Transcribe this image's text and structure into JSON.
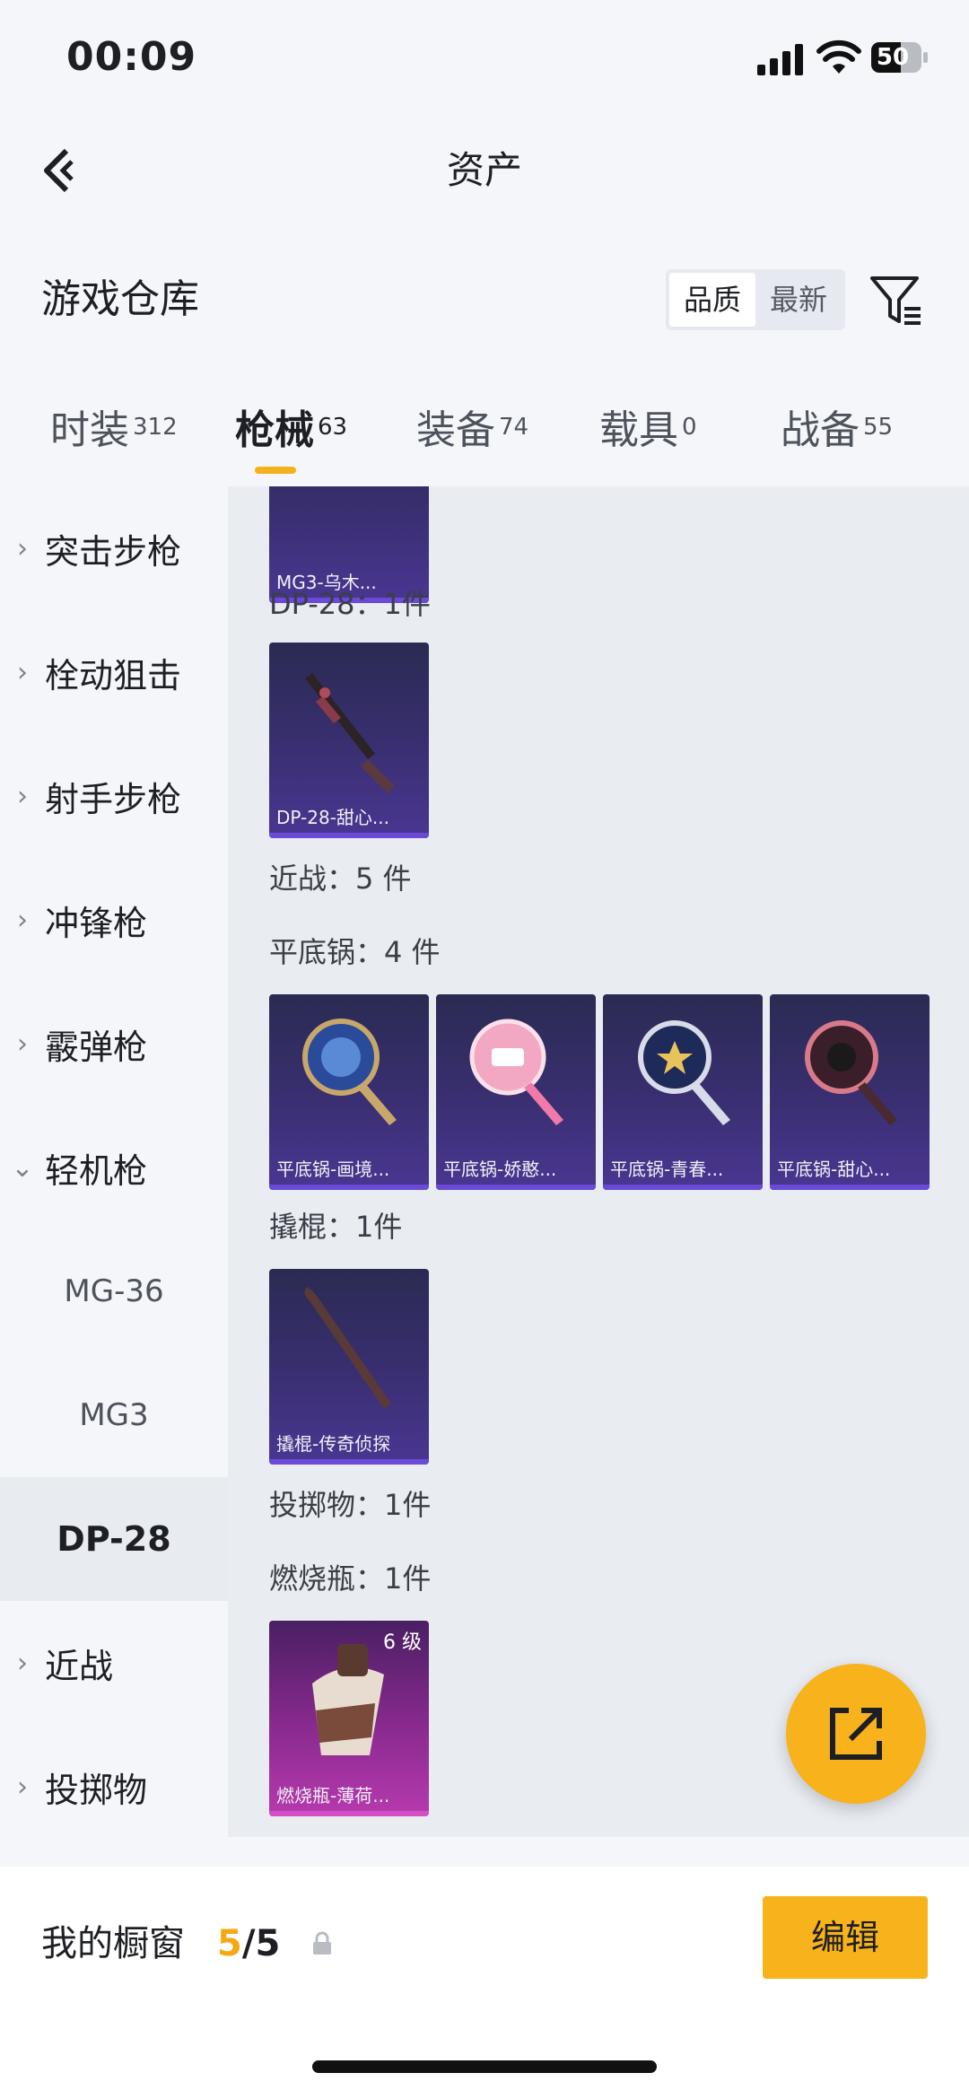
{
  "status_bar": {
    "time": "00:09",
    "battery": "50"
  },
  "header": {
    "title": "资产"
  },
  "section": {
    "title": "游戏仓库",
    "sort_options": [
      "品质",
      "最新"
    ],
    "sort_active": "品质"
  },
  "tabs": [
    {
      "label": "时装",
      "count": "312"
    },
    {
      "label": "枪械",
      "count": "63"
    },
    {
      "label": "装备",
      "count": "74"
    },
    {
      "label": "载具",
      "count": "0"
    },
    {
      "label": "战备",
      "count": "55"
    }
  ],
  "sidebar": {
    "items": [
      "突击步枪",
      "栓动狙击",
      "射手步枪",
      "冲锋枪",
      "霰弹枪",
      "轻机枪"
    ],
    "subitems": [
      "MG-36",
      "MG3",
      "DP-28"
    ],
    "bottom_items": [
      "近战",
      "投掷物"
    ]
  },
  "main": {
    "top_card": "MG3-乌木...",
    "dp28_label": "DP-28：1件",
    "dp28_card": "DP-28-甜心...",
    "melee_label": "近战：5 件",
    "pan_label": "平底锅：4 件",
    "pan_cards": [
      "平底锅-画境...",
      "平底锅-娇憨...",
      "平底锅-青春...",
      "平底锅-甜心..."
    ],
    "crowbar_label": "撬棍：1件",
    "crowbar_card": "撬棍-传奇侦探",
    "throw_label": "投掷物：1件",
    "molotov_label": "燃烧瓶：1件",
    "molotov_card": "燃烧瓶-薄荷...",
    "molotov_level": "6 级"
  },
  "bottom": {
    "showcase_title": "我的橱窗",
    "count_current": "5",
    "count_total": "/5",
    "edit_label": "编辑"
  },
  "colors": {
    "accent": "#f7b21c",
    "card_blue": "#3a2f72",
    "card_purple": "#8a2a8f"
  }
}
